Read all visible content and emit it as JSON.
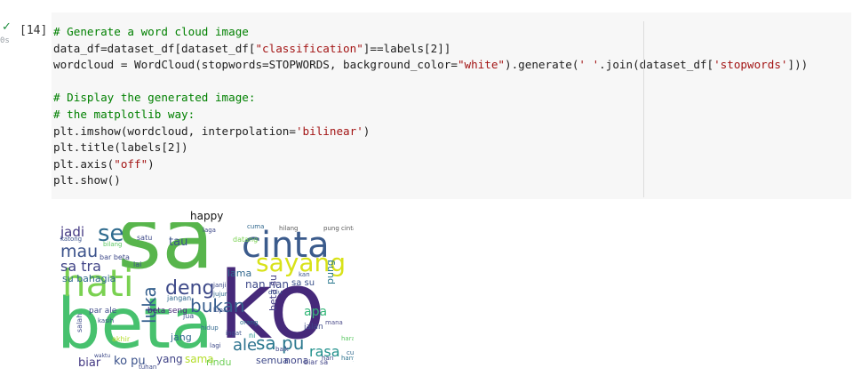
{
  "cell": {
    "execution_count": "[14]",
    "status_icon": "check-icon",
    "run_time": "0s",
    "code_lines": [
      [
        {
          "t": "# Generate a word cloud image",
          "c": "cm"
        }
      ],
      [
        {
          "t": "data_df=dataset_df[dataset_df[",
          "c": ""
        },
        {
          "t": "\"classification\"",
          "c": "st"
        },
        {
          "t": "]==labels[2]]",
          "c": ""
        }
      ],
      [
        {
          "t": "wordcloud = WordCloud(stopwords=STOPWORDS, background_color=",
          "c": ""
        },
        {
          "t": "\"white\"",
          "c": "st"
        },
        {
          "t": ").generate(",
          "c": ""
        },
        {
          "t": "' '",
          "c": "st"
        },
        {
          "t": ".join(dataset_df[",
          "c": ""
        },
        {
          "t": "'stopwords'",
          "c": "st"
        },
        {
          "t": "]))",
          "c": ""
        }
      ],
      [],
      [
        {
          "t": "# Display the generated image:",
          "c": "cm"
        }
      ],
      [
        {
          "t": "# the matplotlib way:",
          "c": "cm"
        }
      ],
      [
        {
          "t": "plt.imshow(wordcloud, interpolation=",
          "c": ""
        },
        {
          "t": "'bilinear'",
          "c": "st"
        },
        {
          "t": ")",
          "c": ""
        }
      ],
      [
        {
          "t": "plt.title(labels[2])",
          "c": ""
        }
      ],
      [
        {
          "t": "plt.axis(",
          "c": ""
        },
        {
          "t": "\"off\"",
          "c": "st"
        },
        {
          "t": ")",
          "c": ""
        }
      ],
      [
        {
          "t": "plt.show()",
          "c": ""
        }
      ]
    ]
  },
  "output": {
    "plot_title": "happy",
    "wordcloud_words": [
      {
        "text": "sa",
        "color": "#58b54c"
      },
      {
        "text": "ko",
        "color": "#46297a"
      },
      {
        "text": "beta",
        "color": "#47c16e"
      },
      {
        "text": "cinta",
        "color": "#3b5b8c"
      },
      {
        "text": "hati",
        "color": "#7ad151"
      },
      {
        "text": "sayang",
        "color": "#d8e219"
      },
      {
        "text": "deng",
        "color": "#3e4a89"
      },
      {
        "text": "bukan",
        "color": "#365d8d"
      },
      {
        "text": "mau",
        "color": "#3b528b"
      },
      {
        "text": "sa tra",
        "color": "#414487"
      },
      {
        "text": "luka",
        "color": "#355f8d"
      },
      {
        "text": "ale",
        "color": "#2c728e"
      },
      {
        "text": "sa pu",
        "color": "#2a788e"
      },
      {
        "text": "rasa",
        "color": "#21918c"
      },
      {
        "text": "apa",
        "color": "#35b779"
      },
      {
        "text": "jadi",
        "color": "#443983"
      },
      {
        "text": "se",
        "color": "#2f6b8e"
      },
      {
        "text": "tau",
        "color": "#3b528b"
      },
      {
        "text": "su bahagia",
        "color": "#31688e"
      },
      {
        "text": "nan nan",
        "color": "#3e4989"
      },
      {
        "text": "beta su",
        "color": "#433e85"
      },
      {
        "text": "pung",
        "color": "#2a788e"
      },
      {
        "text": "hilang",
        "color": "#5b5b5b"
      },
      {
        "text": "pung cinta",
        "color": "#5b5b5b"
      },
      {
        "text": "biar",
        "color": "#443983"
      },
      {
        "text": "ko pu",
        "color": "#3b528b"
      },
      {
        "text": "yang",
        "color": "#414487"
      },
      {
        "text": "sama",
        "color": "#b5de2b"
      },
      {
        "text": "rindu",
        "color": "#6ece58"
      },
      {
        "text": "semua",
        "color": "#3e4989"
      },
      {
        "text": "nona",
        "color": "#404688"
      },
      {
        "text": "jang",
        "color": "#31688e"
      },
      {
        "text": "sa su",
        "color": "#3b528b"
      },
      {
        "text": "jalan",
        "color": "#3e4a89"
      },
      {
        "text": "mana",
        "color": "#4c4c8a"
      },
      {
        "text": "harap",
        "color": "#5cc863"
      },
      {
        "text": "beta seng",
        "color": "#482878"
      },
      {
        "text": "par ale",
        "color": "#3e4a89"
      },
      {
        "text": "kasih",
        "color": "#3b528b"
      },
      {
        "text": "jangan",
        "color": "#31688e"
      },
      {
        "text": "bar beta",
        "color": "#3e4989"
      },
      {
        "text": "katong",
        "color": "#3b528b"
      },
      {
        "text": "bilang",
        "color": "#5cc863"
      },
      {
        "text": "lai",
        "color": "#3b528b"
      },
      {
        "text": "satu",
        "color": "#3e4a89"
      },
      {
        "text": "lama",
        "color": "#31688e"
      },
      {
        "text": "datang",
        "color": "#7ad151"
      },
      {
        "text": "janji",
        "color": "#3e4a89"
      },
      {
        "text": "jujur",
        "color": "#31688e"
      },
      {
        "text": "dulu",
        "color": "#3b528b"
      },
      {
        "text": "baik",
        "color": "#3e4989"
      },
      {
        "text": "hidup",
        "color": "#31688e"
      },
      {
        "text": "lupa",
        "color": "#3b528b"
      },
      {
        "text": "ni",
        "color": "#21918c"
      },
      {
        "text": "orang",
        "color": "#2c728e"
      },
      {
        "text": "hari",
        "color": "#3e4a89"
      },
      {
        "text": "salah",
        "color": "#3e4989"
      },
      {
        "text": "akhir",
        "color": "#b5de2b"
      },
      {
        "text": "jua",
        "color": "#3b528b"
      },
      {
        "text": "biar sa",
        "color": "#414487"
      },
      {
        "text": "waktu",
        "color": "#3e4a89"
      },
      {
        "text": "cukup",
        "color": "#31688e"
      },
      {
        "text": "tuhan",
        "color": "#3e4a89"
      },
      {
        "text": "cuma",
        "color": "#31688e"
      },
      {
        "text": "laga",
        "color": "#3e4989"
      },
      {
        "text": "ingat",
        "color": "#3b528b"
      },
      {
        "text": "hanya",
        "color": "#2c728e"
      },
      {
        "text": "kan",
        "color": "#3b528b"
      },
      {
        "text": "lagi",
        "color": "#3e4a89"
      }
    ]
  }
}
